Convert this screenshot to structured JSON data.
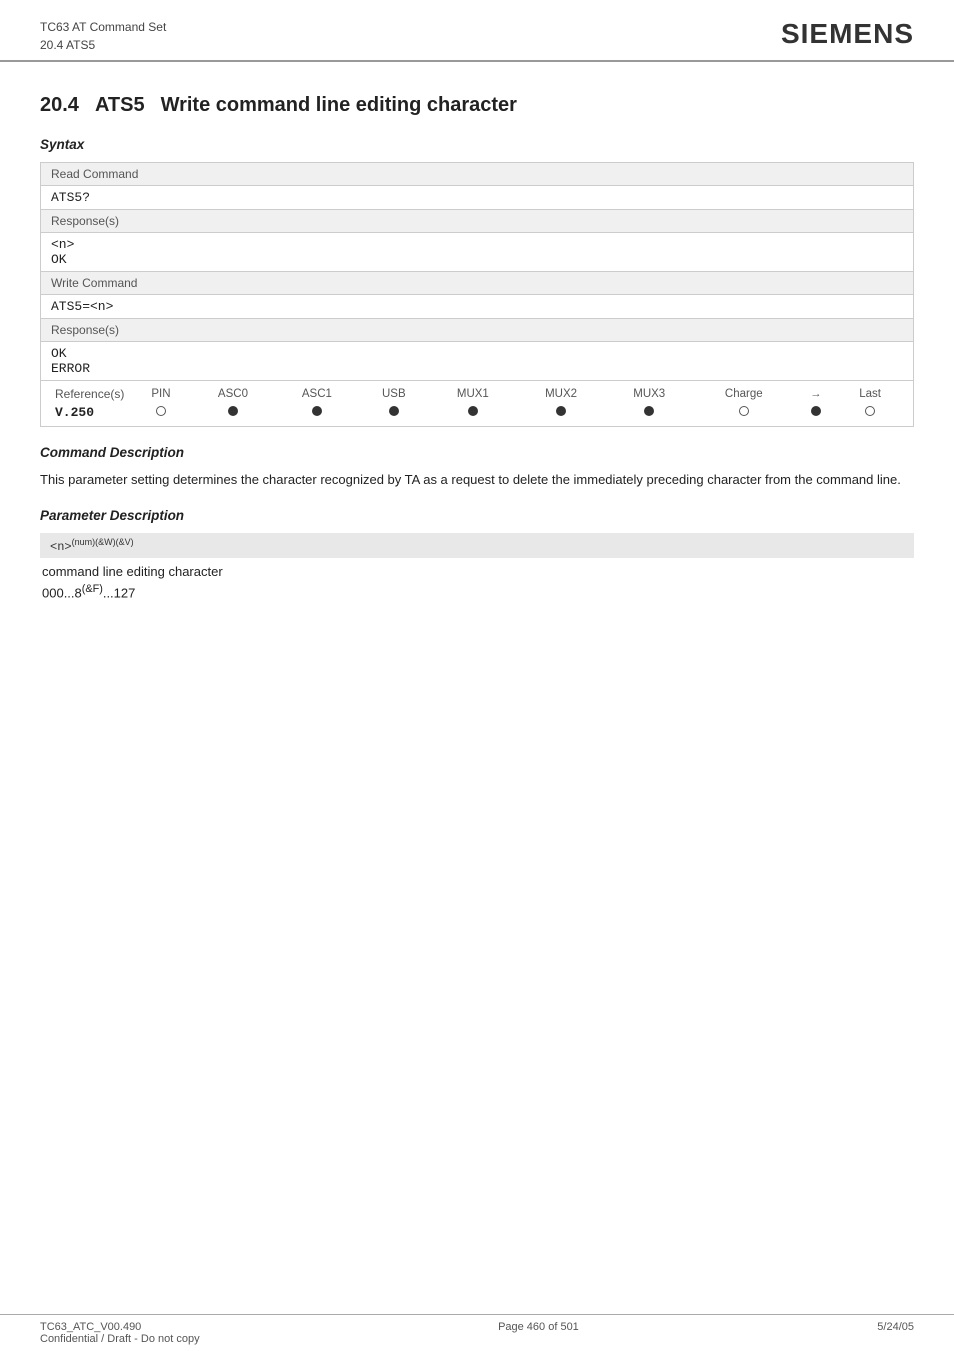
{
  "header": {
    "title_line1": "TC63 AT Command Set",
    "title_line2": "20.4 ATS5",
    "brand": "SIEMENS"
  },
  "section": {
    "number": "20.4",
    "command": "ATS5",
    "title": "Write command line editing character"
  },
  "syntax": {
    "heading": "Syntax",
    "read_command": {
      "label": "Read Command",
      "command": "ATS5?",
      "response_label": "Response(s)",
      "responses": [
        "<n>",
        "OK"
      ]
    },
    "write_command": {
      "label": "Write Command",
      "command": "ATS5=<n>",
      "response_label": "Response(s)",
      "responses": [
        "OK",
        "ERROR"
      ]
    },
    "reference": {
      "label": "Reference(s)",
      "value": "V.250",
      "columns": [
        "PIN",
        "ASC0",
        "ASC1",
        "USB",
        "MUX1",
        "MUX2",
        "MUX3",
        "Charge",
        "→",
        "Last"
      ],
      "values": [
        "empty",
        "filled",
        "filled",
        "filled",
        "filled",
        "filled",
        "filled",
        "empty",
        "filled",
        "empty"
      ]
    }
  },
  "command_description": {
    "heading": "Command Description",
    "text": "This parameter setting determines the character recognized by TA as a request to delete the immediately preceding character from the command line."
  },
  "parameter_description": {
    "heading": "Parameter Description",
    "param_name": "<n>",
    "param_superscript": "(num)(&W)(&V)",
    "desc": "command line editing character",
    "range": "000...8(&F)...127"
  },
  "footer": {
    "left": "TC63_ATC_V00.490",
    "center": "Page 460 of 501",
    "right": "5/24/05",
    "left2": "Confidential / Draft - Do not copy"
  }
}
